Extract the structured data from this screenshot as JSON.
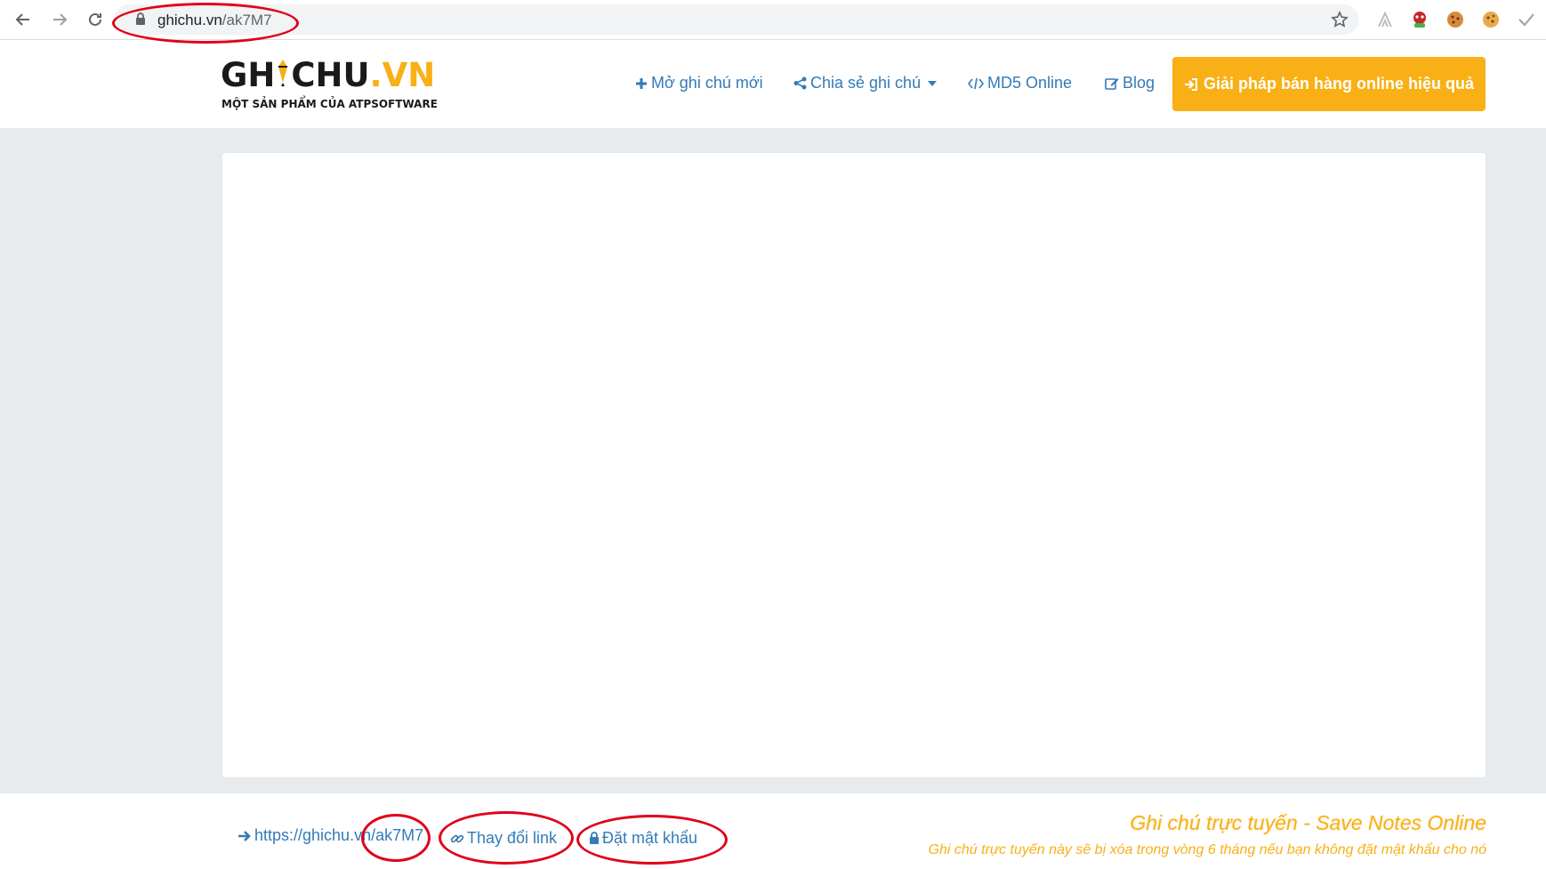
{
  "browser": {
    "url_host": "ghichu.vn",
    "url_path": "/ak7M7"
  },
  "site": {
    "logo_main": "GH",
    "logo_main2": "CHU",
    "logo_tld": ".VN",
    "logo_tagline": "MỘT SẢN PHẨM CỦA ATPSOFTWARE",
    "nav": {
      "new_note": "Mở ghi chú mới",
      "share_note": "Chia sẻ ghi chú",
      "md5": "MD5 Online",
      "blog": "Blog"
    },
    "cta_label": "Giải pháp bán hàng online hiệu quả"
  },
  "note": {
    "content": ""
  },
  "footer": {
    "link_base": "https://ghichu.vn/",
    "link_code": "ak7M7",
    "change_link": "Thay đổi link",
    "set_password": "Đặt mật khẩu",
    "title": "Ghi chú trực tuyến - Save Notes Online",
    "subtitle": "Ghi chú trực tuyến này sẽ bị xóa trong vòng 6 tháng nếu bạn không đặt mật khẩu cho nó"
  },
  "colors": {
    "link": "#337ab7",
    "brand_orange": "#f8b016",
    "annotation_red": "#e0001a"
  },
  "icons": [
    "back-arrow-icon",
    "forward-arrow-icon",
    "reload-icon",
    "lock-icon",
    "star-icon",
    "plus-icon",
    "share-icon",
    "code-icon",
    "edit-icon",
    "sign-in-icon",
    "arrow-right-icon",
    "link-icon",
    "padlock-icon",
    "caret-down-icon"
  ]
}
